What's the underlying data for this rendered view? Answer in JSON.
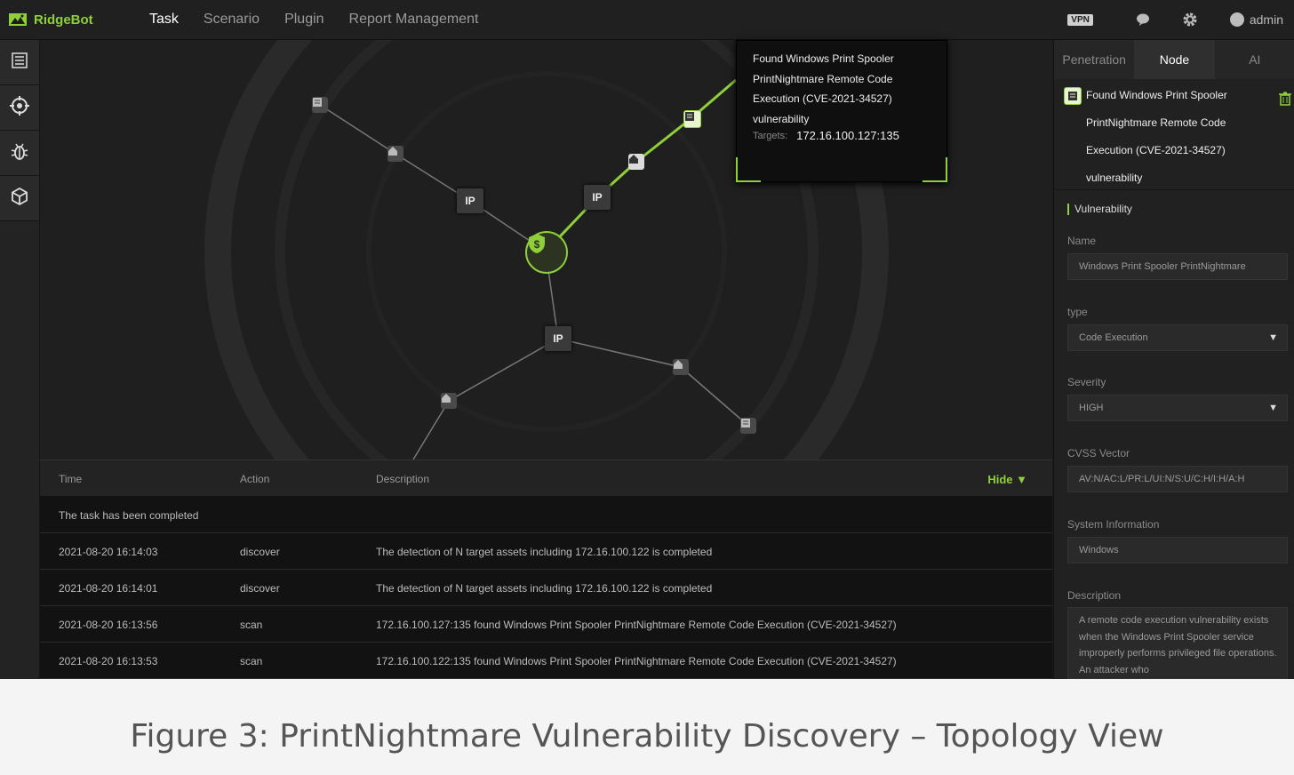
{
  "app": {
    "name": "RidgeBot",
    "nav": [
      {
        "label": "Task",
        "active": true
      },
      {
        "label": "Scenario",
        "active": false
      },
      {
        "label": "Plugin",
        "active": false
      },
      {
        "label": "Report Management",
        "active": false
      }
    ],
    "vpn_badge": "VPN",
    "user": "admin",
    "accent_color": "#8fcf3a"
  },
  "sidebar": {
    "items": [
      {
        "icon": "list-icon"
      },
      {
        "icon": "crosshair-icon"
      },
      {
        "icon": "bug-icon"
      },
      {
        "icon": "cube-icon"
      }
    ]
  },
  "topology": {
    "ip_label": "IP",
    "tooltip": {
      "title": "Found Windows Print Spooler PrintNightmare Remote Code Execution (CVE-2021-34527) vulnerability",
      "targets_label": "Targets:",
      "targets_value": "172.16.100.127:135"
    }
  },
  "log": {
    "headers": {
      "time": "Time",
      "action": "Action",
      "description": "Description"
    },
    "hide_label": "Hide ▼",
    "summary": "The task has been completed",
    "rows": [
      {
        "time": "2021-08-20 16:14:03",
        "action": "discover",
        "description": "The detection of N target assets including 172.16.100.122 is completed"
      },
      {
        "time": "2021-08-20 16:14:01",
        "action": "discover",
        "description": "The detection of N target assets including 172.16.100.122 is completed"
      },
      {
        "time": "2021-08-20 16:13:56",
        "action": "scan",
        "description": "172.16.100.127:135 found Windows Print Spooler PrintNightmare Remote Code Execution (CVE-2021-34527)"
      },
      {
        "time": "2021-08-20 16:13:53",
        "action": "scan",
        "description": "172.16.100.122:135 found Windows Print Spooler PrintNightmare Remote Code Execution (CVE-2021-34527)"
      }
    ]
  },
  "panel": {
    "tabs": [
      {
        "label": "Penetration",
        "active": false
      },
      {
        "label": "Node",
        "active": true
      },
      {
        "label": "AI",
        "active": false
      }
    ],
    "vuln_title": "Found Windows Print Spooler PrintNightmare Remote Code Execution (CVE-2021-34527) vulnerability",
    "section": "Vulnerability",
    "fields": {
      "name_label": "Name",
      "name_value": "Windows Print Spooler PrintNightmare",
      "type_label": "type",
      "type_value": "Code Execution",
      "severity_label": "Severity",
      "severity_value": "HIGH",
      "cvss_label": "CVSS Vector",
      "cvss_value": "AV:N/AC:L/PR:L/UI:N/S:U/C:H/I:H/A:H",
      "sysinfo_label": "System Information",
      "sysinfo_value": "Windows",
      "desc_label": "Description",
      "desc_value": "A remote code execution vulnerability exists when the Windows Print Spooler service improperly performs privileged file operations. An attacker who"
    }
  },
  "caption": "Figure 3: PrintNightmare Vulnerability Discovery – Topology View"
}
